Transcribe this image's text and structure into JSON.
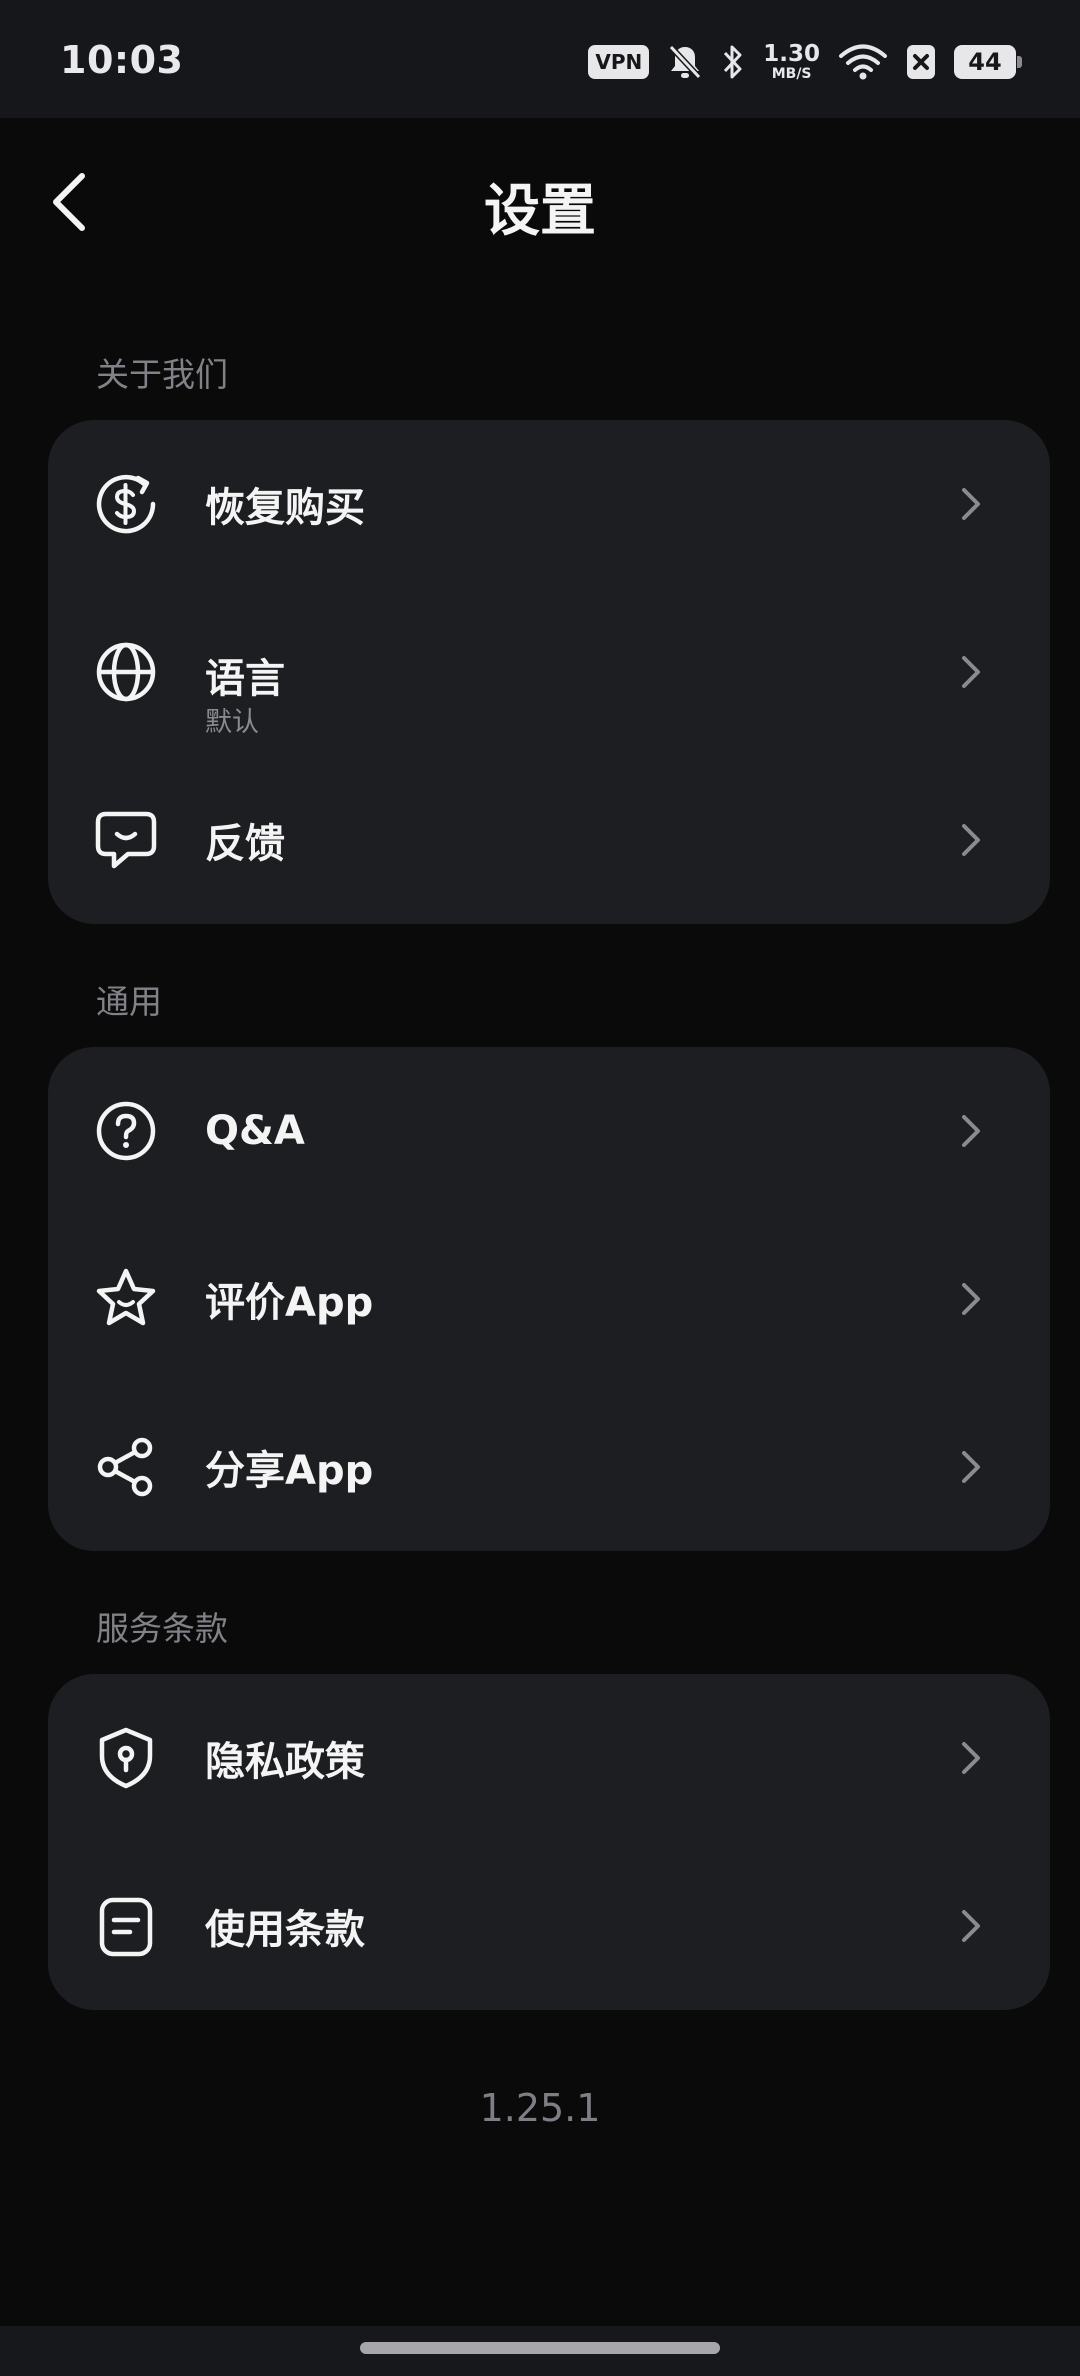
{
  "status_bar": {
    "time": "10:03",
    "vpn": "VPN",
    "speed_value": "1.30",
    "speed_unit": "MB/S",
    "battery": "44"
  },
  "header": {
    "title": "设置"
  },
  "sections": [
    {
      "label": "关于我们",
      "items": [
        {
          "icon": "restore-purchase-icon",
          "label": "恢复购买"
        },
        {
          "icon": "globe-icon",
          "label": "语言",
          "sub": "默认"
        },
        {
          "icon": "feedback-icon",
          "label": "反馈"
        }
      ]
    },
    {
      "label": "通用",
      "items": [
        {
          "icon": "question-icon",
          "label": "Q&A"
        },
        {
          "icon": "star-icon",
          "label": "评价App"
        },
        {
          "icon": "share-icon",
          "label": "分享App"
        }
      ]
    },
    {
      "label": "服务条款",
      "items": [
        {
          "icon": "shield-icon",
          "label": "隐私政策"
        },
        {
          "icon": "document-icon",
          "label": "使用条款"
        }
      ]
    }
  ],
  "version": "1.25.1",
  "colors": {
    "background": "#0a0a0b",
    "card": "#1d1e21",
    "text": "#f4f4f5",
    "muted": "#818187"
  }
}
